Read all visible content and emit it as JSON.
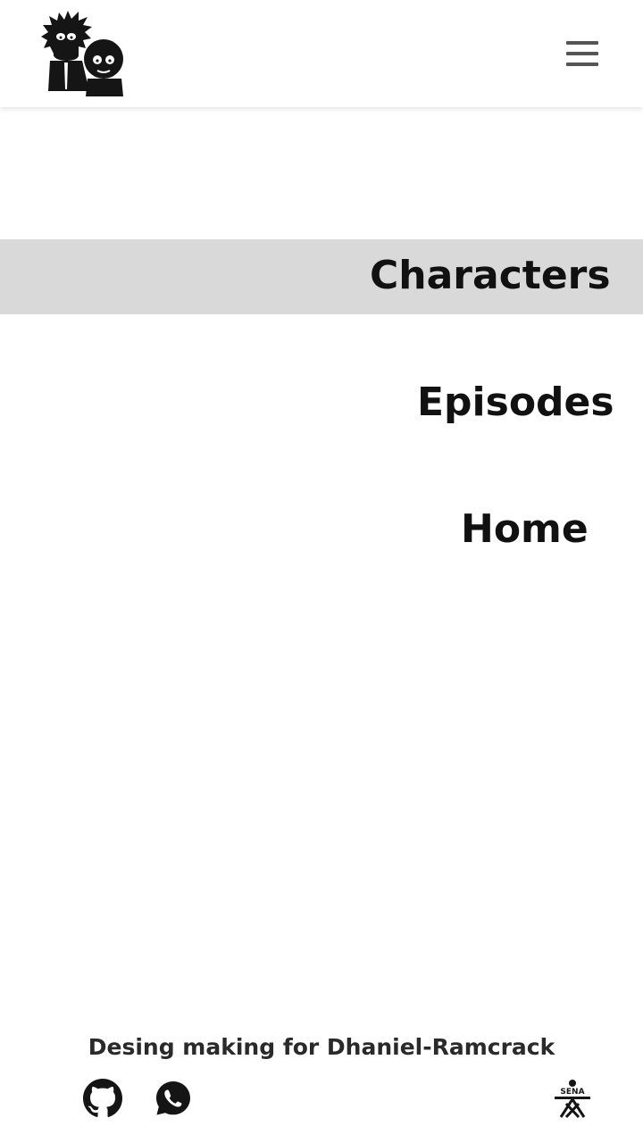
{
  "header": {
    "logo_icon": "rick-and-morty-silhouette-logo",
    "menu_icon": "hamburger-menu-icon"
  },
  "nav": {
    "items": [
      {
        "label": "Characters",
        "active": true
      },
      {
        "label": "Episodes",
        "active": false
      },
      {
        "label": "Home",
        "active": false
      }
    ]
  },
  "footer": {
    "credit": "Desing making for Dhaniel-Ramcrack",
    "icons": [
      "github-icon",
      "whatsapp-icon",
      "sena-logo-icon"
    ],
    "sena_text": "SENA"
  },
  "colors": {
    "active_item_bg": "#d9d9d9",
    "text": "#111111",
    "menu_bars": "#555555"
  }
}
